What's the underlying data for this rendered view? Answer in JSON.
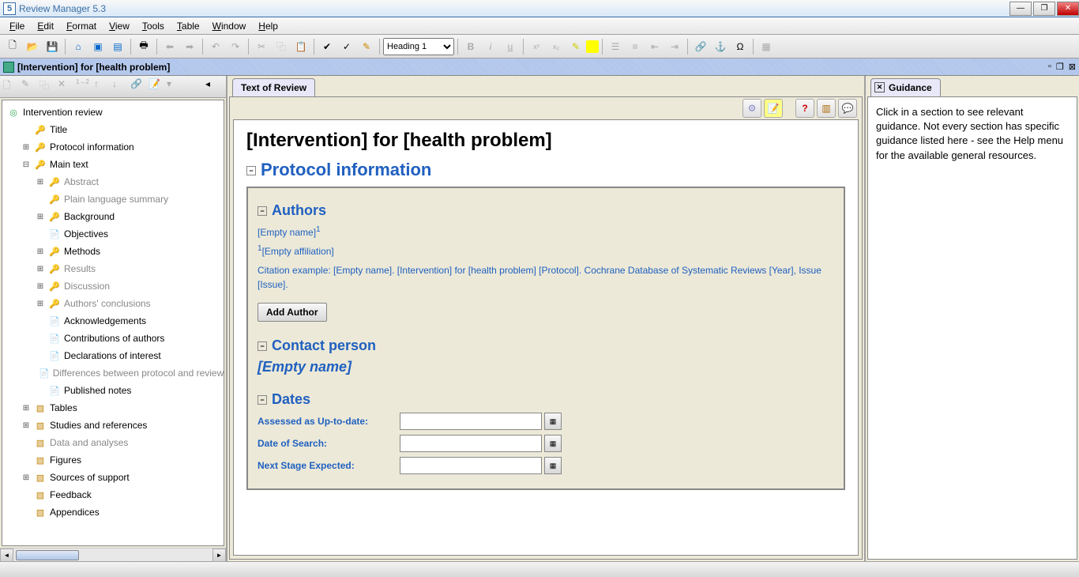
{
  "app": {
    "title": "Review Manager 5.3",
    "icon_digit": "5"
  },
  "menus": [
    "File",
    "Edit",
    "Format",
    "View",
    "Tools",
    "Table",
    "Window",
    "Help"
  ],
  "toolbar": {
    "style_dropdown": "Heading 1"
  },
  "document": {
    "title": "[Intervention] for [health problem]"
  },
  "tree": {
    "root": "Intervention review",
    "items": [
      {
        "label": "Title",
        "depth": 1,
        "grey": false,
        "icon": "key",
        "tog": ""
      },
      {
        "label": "Protocol information",
        "depth": 1,
        "grey": false,
        "icon": "key",
        "tog": "▸"
      },
      {
        "label": "Main text",
        "depth": 1,
        "grey": false,
        "icon": "key",
        "tog": "▾"
      },
      {
        "label": "Abstract",
        "depth": 2,
        "grey": true,
        "icon": "key",
        "tog": "▸"
      },
      {
        "label": "Plain language summary",
        "depth": 2,
        "grey": true,
        "icon": "key",
        "tog": ""
      },
      {
        "label": "Background",
        "depth": 2,
        "grey": false,
        "icon": "key",
        "tog": "▸"
      },
      {
        "label": "Objectives",
        "depth": 2,
        "grey": false,
        "icon": "doc",
        "tog": ""
      },
      {
        "label": "Methods",
        "depth": 2,
        "grey": false,
        "icon": "key",
        "tog": "▸"
      },
      {
        "label": "Results",
        "depth": 2,
        "grey": true,
        "icon": "key",
        "tog": "▸"
      },
      {
        "label": "Discussion",
        "depth": 2,
        "grey": true,
        "icon": "key",
        "tog": "▸"
      },
      {
        "label": "Authors' conclusions",
        "depth": 2,
        "grey": true,
        "icon": "key",
        "tog": "▸"
      },
      {
        "label": "Acknowledgements",
        "depth": 2,
        "grey": false,
        "icon": "doc",
        "tog": ""
      },
      {
        "label": "Contributions of authors",
        "depth": 2,
        "grey": false,
        "icon": "doc",
        "tog": ""
      },
      {
        "label": "Declarations of interest",
        "depth": 2,
        "grey": false,
        "icon": "doc",
        "tog": ""
      },
      {
        "label": "Differences between protocol and review",
        "depth": 2,
        "grey": true,
        "icon": "doc",
        "tog": ""
      },
      {
        "label": "Published notes",
        "depth": 2,
        "grey": false,
        "icon": "doc",
        "tog": ""
      },
      {
        "label": "Tables",
        "depth": 1,
        "grey": false,
        "icon": "folder",
        "tog": "▸"
      },
      {
        "label": "Studies and references",
        "depth": 1,
        "grey": false,
        "icon": "folder",
        "tog": "▸"
      },
      {
        "label": "Data and analyses",
        "depth": 1,
        "grey": true,
        "icon": "folder",
        "tog": ""
      },
      {
        "label": "Figures",
        "depth": 1,
        "grey": false,
        "icon": "folder",
        "tog": ""
      },
      {
        "label": "Sources of support",
        "depth": 1,
        "grey": false,
        "icon": "folder",
        "tog": "▸"
      },
      {
        "label": "Feedback",
        "depth": 1,
        "grey": false,
        "icon": "folder",
        "tog": ""
      },
      {
        "label": "Appendices",
        "depth": 1,
        "grey": false,
        "icon": "folder",
        "tog": ""
      }
    ]
  },
  "center": {
    "tab": "Text of Review",
    "title": "[Intervention] for [health problem]",
    "protocol_heading": "Protocol information",
    "authors_heading": "Authors",
    "empty_name": "[Empty name]",
    "super1": "1",
    "empty_affiliation": "[Empty affiliation]",
    "citation": "Citation example: [Empty name]. [Intervention] for [health problem] [Protocol]. Cochrane Database of Systematic Reviews [Year], Issue [Issue].",
    "add_author": "Add Author",
    "contact_heading": "Contact person",
    "contact_name": "[Empty name]",
    "dates_heading": "Dates",
    "dates": [
      {
        "label": "Assessed as Up-to-date:"
      },
      {
        "label": "Date of Search:"
      },
      {
        "label": "Next Stage Expected:"
      }
    ]
  },
  "guidance": {
    "tab": "Guidance",
    "text": "Click in a section to see relevant guidance. Not every section has specific guidance listed here - see the Help menu for the available general resources."
  }
}
